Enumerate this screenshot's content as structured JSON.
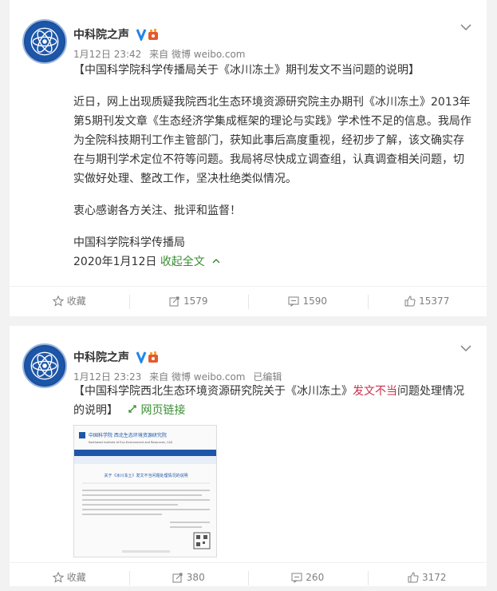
{
  "posts": [
    {
      "author": "中科院之声",
      "meta": {
        "date": "1月12日 23:42",
        "source": "来自 微博 weibo.com",
        "edited": ""
      },
      "title": "【中国科学院科学传播局关于《冰川冻土》期刊发文不当问题的说明】",
      "body": "近日，网上出现质疑我院西北生态环境资源研究院主办期刊《冰川冻土》2013年第5期刊发文章《生态经济学集成框架的理论与实践》学术性不足的信息。我局作为全院科技期刊工作主管部门，获知此事后高度重视，经初步了解，该文确实存在与期刊学术定位不符等问题。我局将尽快成立调查组，认真调查相关问题，切实做好处理、整改工作，坚决杜绝类似情况。",
      "thanks": "衷心感谢各方关注、批评和监督！",
      "sign": "中国科学院科学传播局",
      "sign_date": "2020年1月12日",
      "collapse_label": "收起全文",
      "actions": {
        "favorite": "收藏",
        "repost": "1579",
        "comment": "1590",
        "like": "15377"
      }
    },
    {
      "author": "中科院之声",
      "meta": {
        "date": "1月12日 23:23",
        "source": "来自 微博 weibo.com",
        "edited": "已编辑"
      },
      "title_part1": "【中国科学院西北生态环境资源研究院关于《冰川冻土》",
      "title_highlight": "发文不当",
      "title_part2": "问题处理情况的说明】",
      "link_label": "网页链接",
      "thumb": {
        "org_name_cn": "中国科学院 西北生态环境资源研究院",
        "org_name_en": "Northwest Institute of Eco-Environment and Resources, CAS",
        "doc_title": "关于《冰川冻土》发文不当问题处理情况的说明"
      },
      "actions": {
        "favorite": "收藏",
        "repost": "380",
        "comment": "260",
        "like": "3172"
      }
    }
  ],
  "colors": {
    "link": "#3a8f33",
    "highlight": "#c8314b",
    "verified": "#1f86e9",
    "meta": "#808080"
  }
}
